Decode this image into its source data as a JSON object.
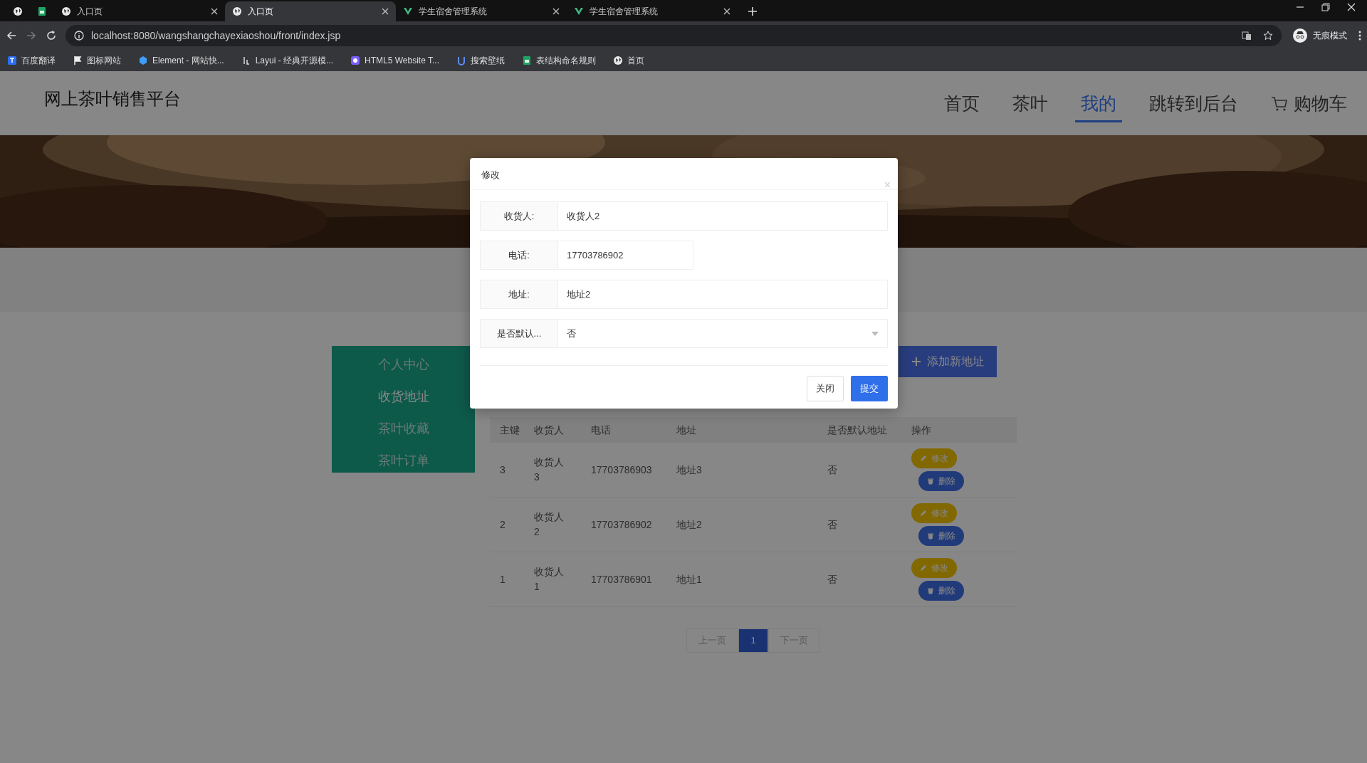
{
  "browser": {
    "tabs": [
      {
        "kind": "pinned",
        "selected": false
      },
      {
        "kind": "pinned",
        "selected": false
      },
      {
        "kind": "tab",
        "title": "入口页",
        "selected": false
      },
      {
        "kind": "tab",
        "title": "入口页",
        "selected": true
      },
      {
        "kind": "tab",
        "title": "学生宿舍管理系统",
        "selected": false
      },
      {
        "kind": "tab",
        "title": "学生宿舍管理系统",
        "selected": false
      }
    ],
    "url": "localhost:8080/wangshangchayexiaoshou/front/index.jsp",
    "profile": "无痕模式",
    "bookmarks": [
      "百度翻译",
      "图标网站",
      "Element - 网站快...",
      "Layui - 经典开源模...",
      "HTML5 Website T...",
      "搜索壁纸",
      "表结构命名规则",
      "首页"
    ]
  },
  "site": {
    "brand": "网上茶叶销售平台",
    "nav": [
      {
        "label": "首页",
        "selected": false,
        "kind": "link"
      },
      {
        "label": "茶叶",
        "selected": false,
        "kind": "link"
      },
      {
        "label": "我的",
        "selected": true,
        "kind": "link"
      },
      {
        "label": "跳转到后台",
        "selected": false,
        "kind": "link"
      },
      {
        "label": "购物车",
        "selected": false,
        "kind": "cart"
      }
    ]
  },
  "sidebar": {
    "items": [
      {
        "label": "个人中心",
        "selected": false
      },
      {
        "label": "收货地址",
        "selected": true
      },
      {
        "label": "茶叶收藏",
        "selected": false
      },
      {
        "label": "茶叶订单",
        "selected": false
      }
    ]
  },
  "add_button": "添加新地址",
  "table": {
    "columns": [
      "主键",
      "收货人",
      "电话",
      "地址",
      "是否默认地址",
      "操作"
    ],
    "rows": [
      {
        "id": "3",
        "receiver": "收货人3",
        "phone": "17703786903",
        "address": "地址3",
        "default": "否",
        "actions": [
          "修改",
          "删除"
        ]
      },
      {
        "id": "2",
        "receiver": "收货人2",
        "phone": "17703786902",
        "address": "地址2",
        "default": "否",
        "actions": [
          "修改",
          "删除"
        ]
      },
      {
        "id": "1",
        "receiver": "收货人1",
        "phone": "17703786901",
        "address": "地址1",
        "default": "否",
        "actions": [
          "修改",
          "删除"
        ]
      }
    ]
  },
  "pagination": [
    {
      "label": "上一页",
      "selected": false
    },
    {
      "label": "1",
      "selected": true
    },
    {
      "label": "下一页",
      "selected": false
    }
  ],
  "modal": {
    "title": "修改",
    "close": "×",
    "fields": [
      {
        "kind": "text",
        "label": "收货人:",
        "value": "收货人2"
      },
      {
        "kind": "short",
        "label": "电话:",
        "value": "17703786902"
      },
      {
        "kind": "text",
        "label": "地址:",
        "value": "地址2"
      },
      {
        "kind": "select",
        "label": "是否默认...",
        "value": "否"
      }
    ],
    "buttons": [
      {
        "kind": "secondary",
        "label": "关闭"
      },
      {
        "kind": "primary",
        "label": "提交"
      }
    ]
  }
}
